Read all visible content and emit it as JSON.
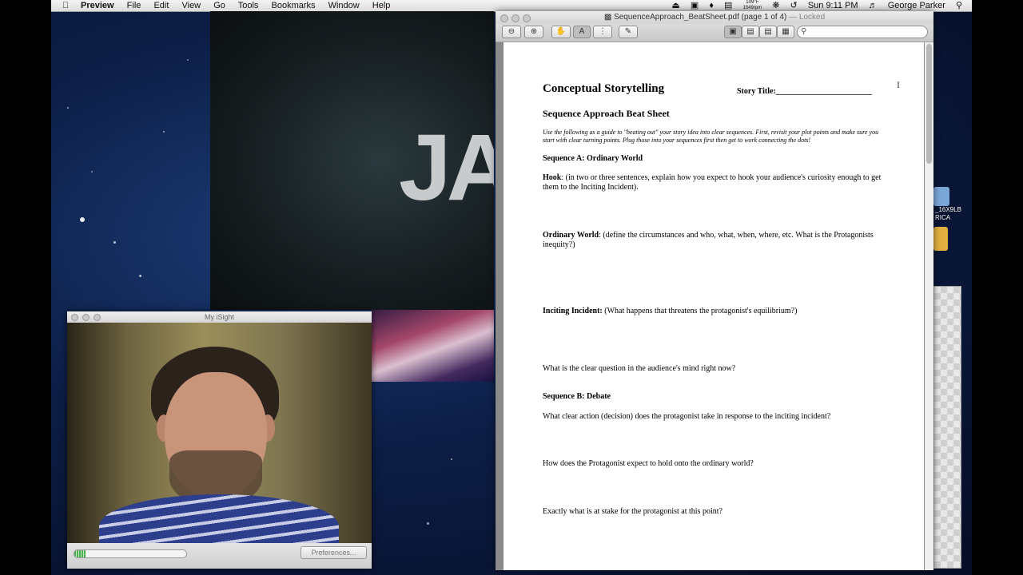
{
  "menubar": {
    "apple": "",
    "items": [
      "Preview",
      "File",
      "Edit",
      "View",
      "Go",
      "Tools",
      "Bookmarks",
      "Window",
      "Help"
    ],
    "temp_top": "109°F",
    "temp_bottom": "1549rpm",
    "clock": "Sun 9:11 PM",
    "user": "George Parker"
  },
  "movie": {
    "letters": "JA"
  },
  "pdf": {
    "title": "SequenceApproach_BeatSheet.pdf (page 1 of 4)",
    "locked": "— Locked",
    "search_placeholder": "",
    "page": {
      "heading": "Conceptual Storytelling",
      "story_title": "Story Title:________________________",
      "subheading": "Sequence Approach Beat Sheet",
      "intro": "Use the following as a guide to \"beating out\" your story idea into clear sequences. First, revisit your plot points and make sure you start with clear turning points. Plug those into your sequences first then get to work connecting the dots!",
      "seq_a": "Sequence A: Ordinary World",
      "hook_label": "Hook",
      "hook_text": ": (in two or three sentences, explain how you expect to hook your audience's curiosity enough to get them to the Inciting Incident).",
      "ordinary_label": "Ordinary World",
      "ordinary_text": ": (define the circumstances and who, what, when, where, etc. What is the Protagonists inequity?)",
      "inciting_label": "Inciting Incident:",
      "inciting_text": " (What happens that threatens the protagonist's equilibrium?)",
      "q1": "What is the clear question in the audience's mind right now?",
      "seq_b": "Sequence B: Debate",
      "q2": "What clear action (decision) does the protagonist take in response to the inciting incident?",
      "q3": "How does the Protagonist expect to hold onto the ordinary world?",
      "q4": "Exactly what is at stake for the protagonist at this point?"
    }
  },
  "desktop": {
    "label1": "_16X9LB",
    "label2": "RICA"
  },
  "isight": {
    "title": "My iSight",
    "level": 0.1,
    "prefs_label": "Preferences..."
  }
}
